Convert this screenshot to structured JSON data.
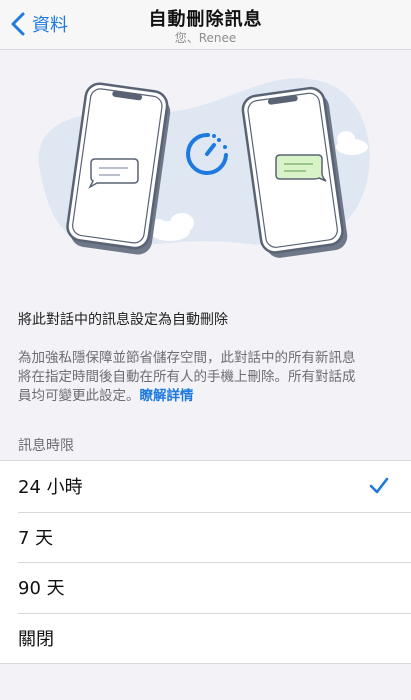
{
  "nav": {
    "back_label": "資料",
    "title": "自動刪除訊息",
    "subtitle": "您、Renee"
  },
  "description": {
    "main": "將此對話中的訊息設定為自動刪除",
    "detail_line1": "為加強私隱保障並節省儲存空間，此對話中的所有新訊息",
    "detail_line2": "將在指定時間後自動在所有人的手機上刪除。所有對話成",
    "detail_line3": "員均可變更此設定。",
    "learn_more": "瞭解詳情"
  },
  "section": {
    "header": "訊息時限"
  },
  "options": [
    {
      "label": "24 小時",
      "selected": true
    },
    {
      "label": "7 天",
      "selected": false
    },
    {
      "label": "90 天",
      "selected": false
    },
    {
      "label": "關閉",
      "selected": false
    }
  ],
  "colors": {
    "accent": "#1f7ae0",
    "bubble_left": "#ffffff",
    "bubble_right": "#d8f3c8",
    "blob": "#dfe7f3",
    "background": "#f2f2f7"
  }
}
